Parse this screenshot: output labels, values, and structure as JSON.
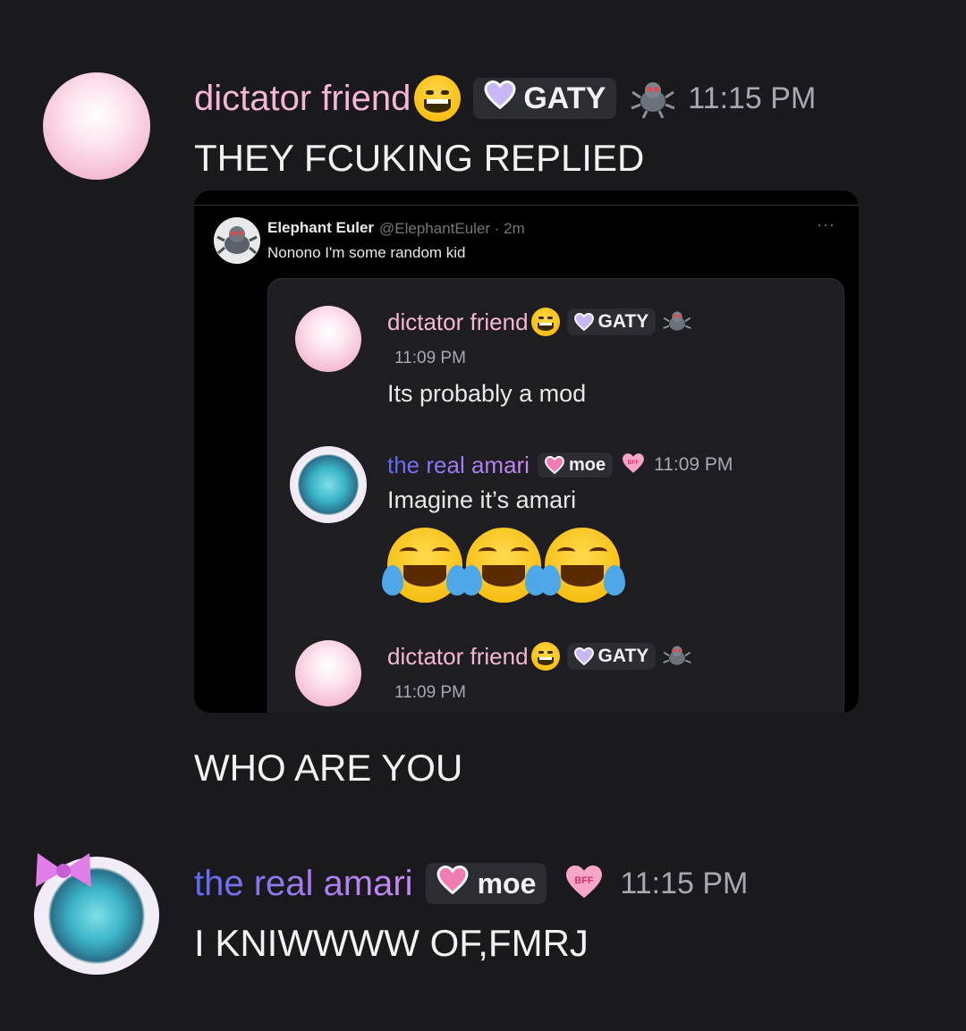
{
  "messages": [
    {
      "username": "dictator friend",
      "tag": "GATY",
      "time": "11:15 PM",
      "text": "THEY FCUKING REPLIED"
    },
    {
      "text": "WHO ARE YOU"
    },
    {
      "username": "the real amari",
      "tag": "moe",
      "badge": "BFF",
      "time": "11:15 PM",
      "text": "I KNIWWWW OF,FMRJ"
    }
  ],
  "embed": {
    "tweet": {
      "name": "Elephant Euler",
      "handle": "@ElephantEuler · 2m",
      "text": "Nonono I'm some random kid",
      "more": "···"
    },
    "inner_messages": [
      {
        "username": "dictator friend",
        "tag": "GATY",
        "time": "11:09 PM",
        "text": "Its probably a mod"
      },
      {
        "username": "the real amari",
        "tag": "moe",
        "badge": "BFF",
        "time": "11:09 PM",
        "text": "Imagine it’s amari"
      },
      {
        "username": "dictator friend",
        "tag": "GATY",
        "time": "11:09 PM"
      }
    ]
  },
  "colors": {
    "background": "#1a1a1e",
    "name_pink": "#f6b6d6",
    "name_gradient_start": "#5b6cf2",
    "name_gradient_end": "#c98bf0",
    "timestamp": "#a8a8b0"
  },
  "icons": [
    "grinning-emoji-icon",
    "lavender-heart-icon",
    "pink-heart-icon",
    "bug-badge-icon",
    "bff-heart-icon",
    "laughing-tears-emoji-icon"
  ]
}
